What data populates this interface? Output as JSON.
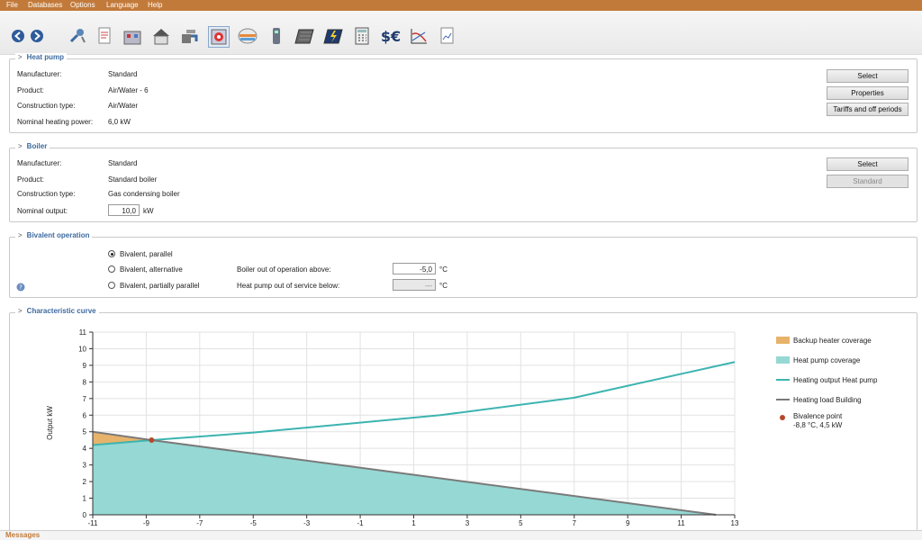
{
  "menu": [
    "File",
    "Databases",
    "Options",
    "Language",
    "Help"
  ],
  "toolbar": {
    "icons": [
      "back-arrow-icon",
      "forward-arrow-icon",
      "settings-icon",
      "document-icon",
      "building-icon",
      "house-icon",
      "heat-pump-tap-icon",
      "heat-pump-icon",
      "storage-tank-icon",
      "boiler-icon",
      "solar-collector-icon",
      "pv-module-icon",
      "calculator-icon",
      "currency-icon",
      "chart-curve-icon",
      "report-icon"
    ]
  },
  "heat_pump": {
    "title": "Heat pump",
    "rows": [
      {
        "label": "Manufacturer:",
        "value": "Standard"
      },
      {
        "label": "Product:",
        "value": "Air/Water - 6"
      },
      {
        "label": "Construction type:",
        "value": "Air/Water"
      },
      {
        "label": "Nominal heating power:",
        "value": "6,0 kW"
      }
    ],
    "buttons": [
      "Select",
      "Properties",
      "Tariffs and off periods"
    ]
  },
  "boiler": {
    "title": "Boiler",
    "rows": [
      {
        "label": "Manufacturer:",
        "value": "Standard"
      },
      {
        "label": "Product:",
        "value": "Standard boiler"
      },
      {
        "label": "Construction type:",
        "value": "Gas condensing boiler"
      }
    ],
    "nominal_output_label": "Nominal output:",
    "nominal_output_value": "10,0",
    "nominal_output_unit": "kW",
    "buttons": [
      "Select",
      "Standard"
    ]
  },
  "bivalent": {
    "title": "Bivalent operation",
    "options": [
      "Bivalent, parallel",
      "Bivalent, alternative",
      "Bivalent, partially parallel"
    ],
    "selected": 0,
    "boiler_out_label": "Boiler out of operation above:",
    "boiler_out_value": "-5,0",
    "hp_out_label": "Heat pump out of service below:",
    "hp_out_value": "---",
    "unit": "°C"
  },
  "curve": {
    "title": "Characteristic curve"
  },
  "chart_data": {
    "type": "line",
    "ylabel": "Output kW",
    "xlim": [
      -11,
      13
    ],
    "ylim": [
      0,
      11
    ],
    "x_ticks": [
      -11,
      -9,
      -7,
      -5,
      -3,
      -1,
      1,
      3,
      5,
      7,
      9,
      11,
      13
    ],
    "y_ticks": [
      0,
      1,
      2,
      3,
      4,
      5,
      6,
      7,
      8,
      9,
      10,
      11
    ],
    "series": [
      {
        "name": "Heating output Heat pump",
        "color": "#3cb4b0",
        "x": [
          -11,
          -8.8,
          -5,
          -2,
          2,
          7,
          13
        ],
        "y": [
          4.2,
          4.5,
          4.95,
          5.4,
          6.0,
          7.05,
          9.2
        ]
      },
      {
        "name": "Heating load Building",
        "color": "#7a7a7a",
        "x": [
          -11,
          -8.8,
          12.3
        ],
        "y": [
          5.0,
          4.5,
          0
        ]
      }
    ],
    "legend": [
      {
        "name": "Backup heater coverage",
        "color": "#e7b36a"
      },
      {
        "name": "Heat pump coverage",
        "color": "#95d8d4"
      },
      {
        "name": "Heating output Heat pump",
        "color": "#3cb4b0"
      },
      {
        "name": "Heating load Building",
        "color": "#7a7a7a"
      }
    ],
    "bivalence_point": {
      "label": "Bivalence point",
      "detail": "-8,8 °C, 4,5 kW",
      "x": -8.8,
      "y": 4.5,
      "color": "#b5482a"
    }
  },
  "status": {
    "messages": "Messages"
  }
}
